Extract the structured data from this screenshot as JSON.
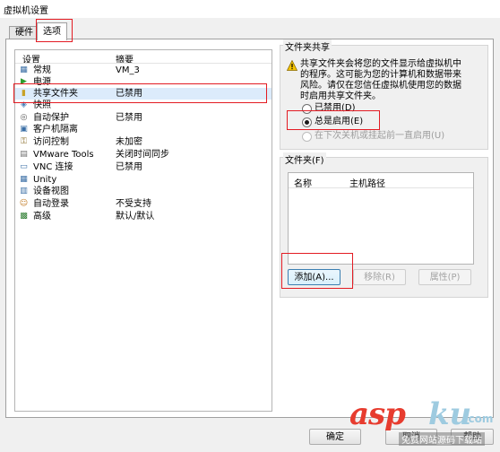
{
  "window": {
    "title": "虚拟机设置"
  },
  "tabs": [
    {
      "label": "硬件"
    },
    {
      "label": "选项"
    }
  ],
  "settings_list": {
    "header": {
      "settings": "设置",
      "summary": "摘要"
    },
    "rows": [
      {
        "name": "常规",
        "summary": "VM_3",
        "icon": "general-icon"
      },
      {
        "name": "电源",
        "summary": "",
        "icon": "power-icon"
      },
      {
        "name": "共享文件夹",
        "summary": "已禁用",
        "icon": "shared-folder-icon"
      },
      {
        "name": "快照",
        "summary": "",
        "icon": "snapshot-icon"
      },
      {
        "name": "自动保护",
        "summary": "已禁用",
        "icon": "autoprotect-icon"
      },
      {
        "name": "客户机隔离",
        "summary": "",
        "icon": "isolation-icon"
      },
      {
        "name": "访问控制",
        "summary": "未加密",
        "icon": "access-control-icon"
      },
      {
        "name": "VMware Tools",
        "summary": "关闭时间同步",
        "icon": "vmware-tools-icon"
      },
      {
        "name": "VNC 连接",
        "summary": "已禁用",
        "icon": "vnc-icon"
      },
      {
        "name": "Unity",
        "summary": "",
        "icon": "unity-icon"
      },
      {
        "name": "设备视图",
        "summary": "",
        "icon": "device-view-icon"
      },
      {
        "name": "自动登录",
        "summary": "不受支持",
        "icon": "autologin-icon"
      },
      {
        "name": "高级",
        "summary": "默认/默认",
        "icon": "advanced-icon"
      }
    ]
  },
  "folder_sharing": {
    "label": "文件夹共享",
    "warning": [
      "共享文件夹会将您的文件显示给虚拟机中",
      "的程序。这可能为您的计算机和数据带来",
      "风险。请仅在您信任虚拟机使用您的数据",
      "时启用共享文件夹。"
    ],
    "options": [
      {
        "label": "已禁用(D)",
        "selected": false,
        "enabled": true
      },
      {
        "label": "总是启用(E)",
        "selected": true,
        "enabled": true
      },
      {
        "label": "在下次关机或挂起前一直启用(U)",
        "selected": false,
        "enabled": false
      }
    ]
  },
  "folders": {
    "label": "文件夹(F)",
    "columns": {
      "name": "名称",
      "host_path": "主机路径"
    },
    "buttons": {
      "add": "添加(A)...",
      "remove": "移除(R)",
      "properties": "属性(P)"
    }
  },
  "dialog_buttons": {
    "ok": "确定",
    "cancel": "取消",
    "help": "帮助"
  },
  "watermark": {
    "brand_a": "asp",
    "brand_b": "ku",
    "brand_c": ".com",
    "sub": "免费网站源码下载站"
  },
  "colors": {
    "annotation": "#e31b23",
    "selection": "#dcebfb",
    "warning": "#f5c400"
  }
}
